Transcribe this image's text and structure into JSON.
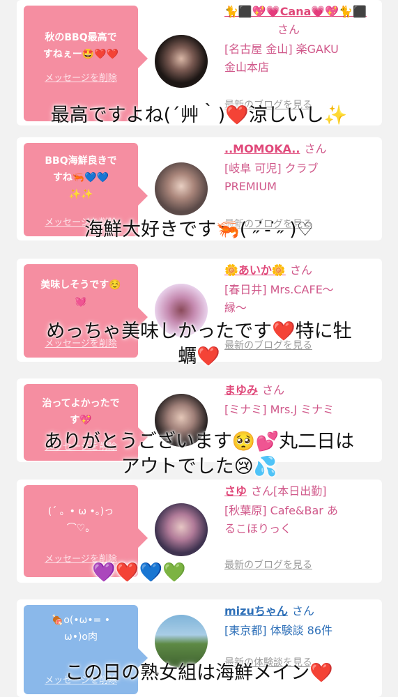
{
  "cards": [
    {
      "message": "秋のBBQ最高で\nすねぇー🤩❤️❤️",
      "delete_label": "メッセージを削除",
      "name": "🐈⬛💖💗Cana💗💖🐈⬛",
      "san": "さん",
      "shop": "[名古屋 金山] 楽GAKU\n金山本店",
      "link": "最新のブログを見る"
    },
    {
      "message": "BBQ海鮮良きで\nすね🦐💙💙\n✨✨",
      "delete_label": "メッセージを削除",
      "name": "..MOMOKA..",
      "san": "さん",
      "shop": "[岐阜 可児] クラブ\nPREMIUM",
      "link": "最新のブログを見る"
    },
    {
      "message": "美味しそうです☺️\n💓",
      "delete_label": "メッセージを削除",
      "name": "🌼あいか🌼",
      "san": "さん",
      "shop": "[春日井] Mrs.CAFE〜\n縁〜",
      "link": "最新のブログを見る"
    },
    {
      "message": "治ってよかったで\nす💖",
      "delete_label": "メッセージを削除",
      "name": "まゆみ",
      "san": "さん",
      "shop": "[ミナミ] Mrs.J ミナミ",
      "link": "最新のブログを見る"
    },
    {
      "message": "(´ 。• ω •。)っ\n⌒♡。",
      "delete_label": "メッセージを削除",
      "name": "さゆ",
      "san": "さん[本日出勤]",
      "shop": "[秋葉原] Cafe&Bar あ\nるこほりっく",
      "link": "最新のブログを見る"
    },
    {
      "message": "🍖o(•ω•= •\nω•)o肉",
      "delete_label": "メッセージを削除",
      "name": "mizuちゃん",
      "san": "さん",
      "shop": "[東京都] 体験談 86件",
      "link": "最新の体験談を見る"
    }
  ],
  "captions": {
    "c1": "最高ですよね(´艸｀)❤️涼しいし✨",
    "c2": "海鮮大好きです🦐( ˶ ̇ ̵ ̇˶ )♡",
    "c3": "めっちゃ美味しかったです❤️特に牡\n蠣❤️",
    "c4": "ありがとうございます🥺💕丸二日は\nアウトでした😢💦",
    "c5": "💜❤️💙💚",
    "c6": "この日の熟女組は海鮮メイン❤️"
  },
  "colors": {
    "pink_bubble": "#f58ea1",
    "blue_bubble": "#8ab8ea",
    "pink_text": "#e0497a",
    "blue_text": "#2d6fb8"
  }
}
